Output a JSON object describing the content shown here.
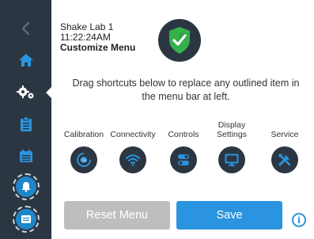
{
  "device": {
    "name": "Shake Lab 1",
    "time": "11:22:24AM",
    "screen_title": "Customize Menu"
  },
  "instructions": "Drag shortcuts below to replace any outlined item in the menu bar at left.",
  "sidebar": {
    "items": [
      {
        "icon": "chevron-left-icon"
      },
      {
        "icon": "home-icon"
      },
      {
        "icon": "settings-gears-icon",
        "active": true
      },
      {
        "icon": "clipboard-icon"
      },
      {
        "icon": "calendar-icon"
      },
      {
        "icon": "alarm-bell-icon",
        "outlined": true
      },
      {
        "icon": "message-icon",
        "outlined": true
      }
    ]
  },
  "shortcuts": [
    {
      "label": "Calibration",
      "icon": "calibration-icon"
    },
    {
      "label": "Connectivity",
      "icon": "wifi-icon"
    },
    {
      "label": "Controls",
      "icon": "toggle-switches-icon"
    },
    {
      "label": "Display Settings",
      "icon": "monitor-icon"
    },
    {
      "label": "Service",
      "icon": "tools-icon"
    }
  ],
  "buttons": {
    "reset_label": "Reset Menu",
    "save_label": "Save"
  },
  "info": {
    "glyph": "i"
  },
  "colors": {
    "sidebar": "#2b3642",
    "accent": "#2a94e0",
    "status_ok": "#34b24a",
    "disabled": "#bcbec0"
  }
}
